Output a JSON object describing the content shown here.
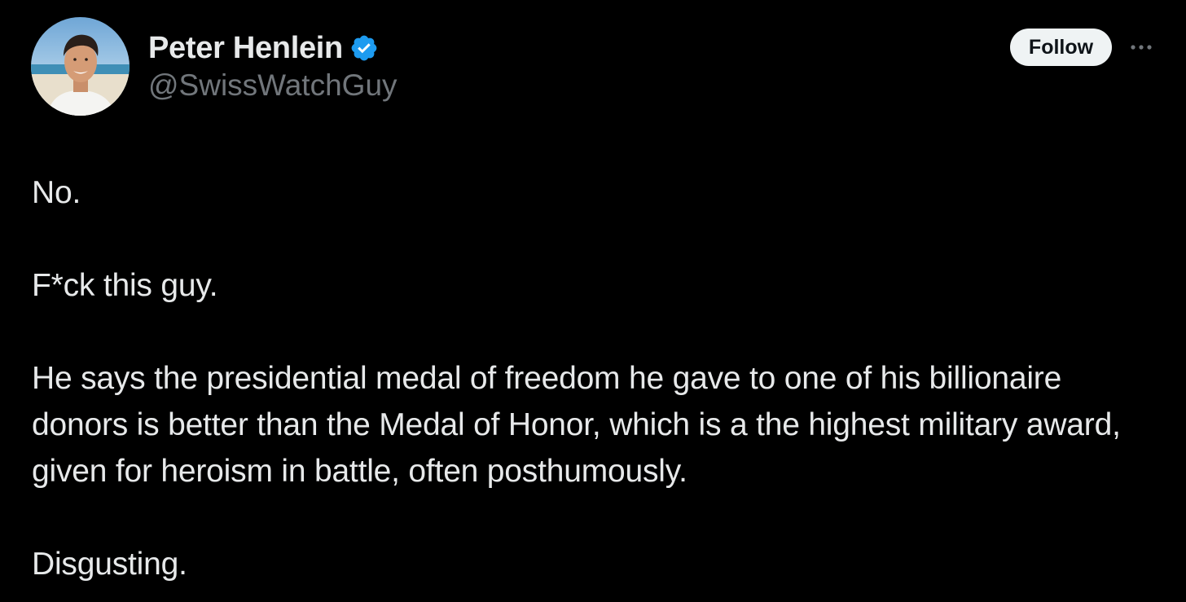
{
  "author": {
    "display_name": "Peter Henlein",
    "handle": "@SwissWatchGuy",
    "verified": true,
    "verified_icon": "verified-badge-icon",
    "avatar_icon": "profile-avatar"
  },
  "actions": {
    "follow_label": "Follow",
    "more_icon": "more-options-icon"
  },
  "tweet": {
    "paragraphs": [
      "No.",
      "F*ck this guy.",
      "He says the presidential medal of freedom he gave to one of his billionaire donors is better than the Medal of Honor, which is a the highest military award, given for heroism in battle, often posthumously.",
      "Disgusting."
    ]
  },
  "colors": {
    "background": "#000000",
    "text_primary": "#e7e9ea",
    "text_secondary": "#71767b",
    "verified_blue": "#1d9bf0",
    "follow_bg": "#eff3f4",
    "follow_text": "#0f1419"
  }
}
